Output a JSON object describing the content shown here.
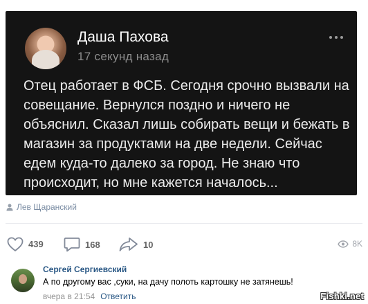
{
  "post": {
    "author": "Даша Пахова",
    "time": "17 секунд назад",
    "text": "Отец работает в ФСБ. Сегодня срочно вызвали на совещание. Вернулся поздно и ничего не объяснил. Сказал лишь собирать вещи и бежать в магазин за продуктами на две недели. Сейчас едем куда-то далеко за город. Не знаю что происходит, но мне кажется началось..."
  },
  "source": {
    "name": "Лев Щаранский",
    "icon": "person-icon"
  },
  "actions": {
    "likes": "439",
    "comments": "168",
    "shares": "10",
    "views": "8K"
  },
  "comment": {
    "author": "Сергей Сергиевский",
    "text": "А по другому вас ,суки, на дачу полоть картошку не затянешь!",
    "time": "вчера в 21:54",
    "reply_label": "Ответить"
  },
  "watermark": "Fishki.net",
  "colors": {
    "link": "#2a5885",
    "card_bg": "#141414"
  }
}
